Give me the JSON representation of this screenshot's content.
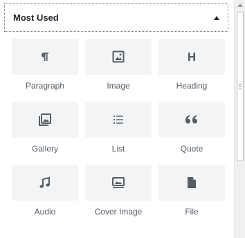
{
  "section": {
    "title": "Most Used"
  },
  "blocks": [
    {
      "label": "Paragraph",
      "icon": "paragraph-icon"
    },
    {
      "label": "Image",
      "icon": "image-icon"
    },
    {
      "label": "Heading",
      "icon": "heading-icon"
    },
    {
      "label": "Gallery",
      "icon": "gallery-icon"
    },
    {
      "label": "List",
      "icon": "list-icon"
    },
    {
      "label": "Quote",
      "icon": "quote-icon"
    },
    {
      "label": "Audio",
      "icon": "audio-icon"
    },
    {
      "label": "Cover Image",
      "icon": "cover-image-icon"
    },
    {
      "label": "File",
      "icon": "file-icon"
    }
  ],
  "colors": {
    "tile_bg": "#f3f4f5",
    "icon": "#555d66",
    "label": "#555d66"
  }
}
